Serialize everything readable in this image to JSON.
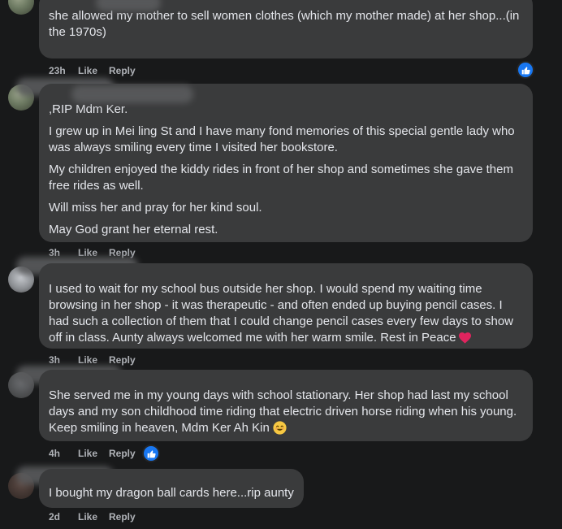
{
  "comments": [
    {
      "lines": [
        "she allowed my mother to sell women clothes (which my mother made) at her shop...(in the 1970s)"
      ],
      "time": "23h",
      "like": "Like",
      "reply": "Reply"
    },
    {
      "lines": [
        ",RIP Mdm Ker.",
        "I grew up in Mei ling St and I have many fond memories of this special gentle lady who was always smiling every time I visited her bookstore.",
        "My children enjoyed the kiddy rides in front of her shop and sometimes she gave them free rides as well.",
        "Will miss her and pray for her kind soul.",
        "May God grant her eternal rest."
      ],
      "time": "3h",
      "like": "Like",
      "reply": "Reply"
    },
    {
      "lines": [
        "I used to wait for my school bus outside her shop. I would spend my waiting time browsing in her shop - it was therapeutic - and often ended up buying pencil cases. I had such a collection of them that I could change pencil cases every few days to show off in class. Aunty always welcomed me with her warm smile. Rest in Peace"
      ],
      "time": "3h",
      "like": "Like",
      "reply": "Reply"
    },
    {
      "lines": [
        "She served me in my young days with school stationary. Her shop had last my school days and my son childhood time riding that electric driven horse riding when his young. Keep smiling in heaven, Mdm Ker Ah Kin"
      ],
      "time": "4h",
      "like": "Like",
      "reply": "Reply"
    },
    {
      "lines": [
        "I bought my dragon ball cards here...rip aunty"
      ],
      "time": "2d",
      "like": "Like",
      "reply": "Reply"
    }
  ],
  "icons": {
    "like_reaction": "thumbs-up-icon",
    "heart": "red-heart-emoji",
    "smile": "smiling-face-emoji"
  },
  "colors": {
    "background": "#18191a",
    "bubble": "#3a3b3c",
    "text": "#e4e6eb",
    "meta": "#b0b3b8",
    "reaction": "#1877f2",
    "heart": "#e0245e"
  }
}
